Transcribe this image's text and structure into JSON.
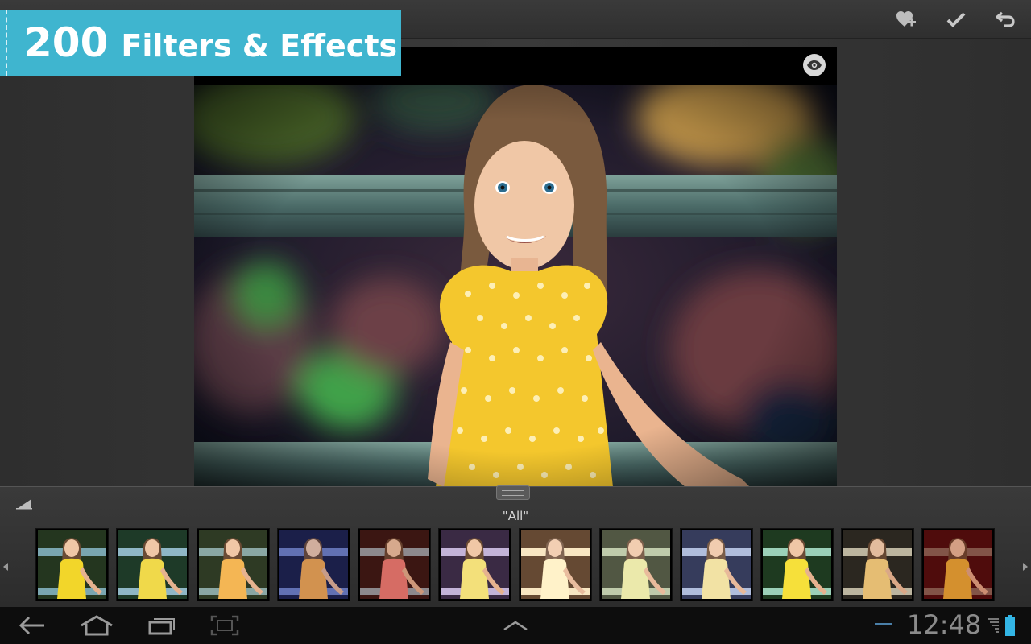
{
  "banner": {
    "count": "200",
    "text": "Filters & Effects"
  },
  "toolbar": {
    "favorite_icon": "heart-plus-icon",
    "apply_icon": "checkmark-icon",
    "undo_icon": "undo-icon"
  },
  "preview": {
    "eye_icon": "eye-icon"
  },
  "filter_panel": {
    "category_label": "\"All\"",
    "thumbnail_count": 12
  },
  "system_bar": {
    "time": "12:48",
    "back_icon": "back-icon",
    "home_icon": "home-icon",
    "recents_icon": "recent-apps-icon",
    "screenshot_icon": "screenshot-icon",
    "menu_icon": "chevron-up-icon",
    "battery_color": "#33b5e5"
  },
  "colors": {
    "banner": "#3fb5cf",
    "accent": "#33b5e5"
  }
}
